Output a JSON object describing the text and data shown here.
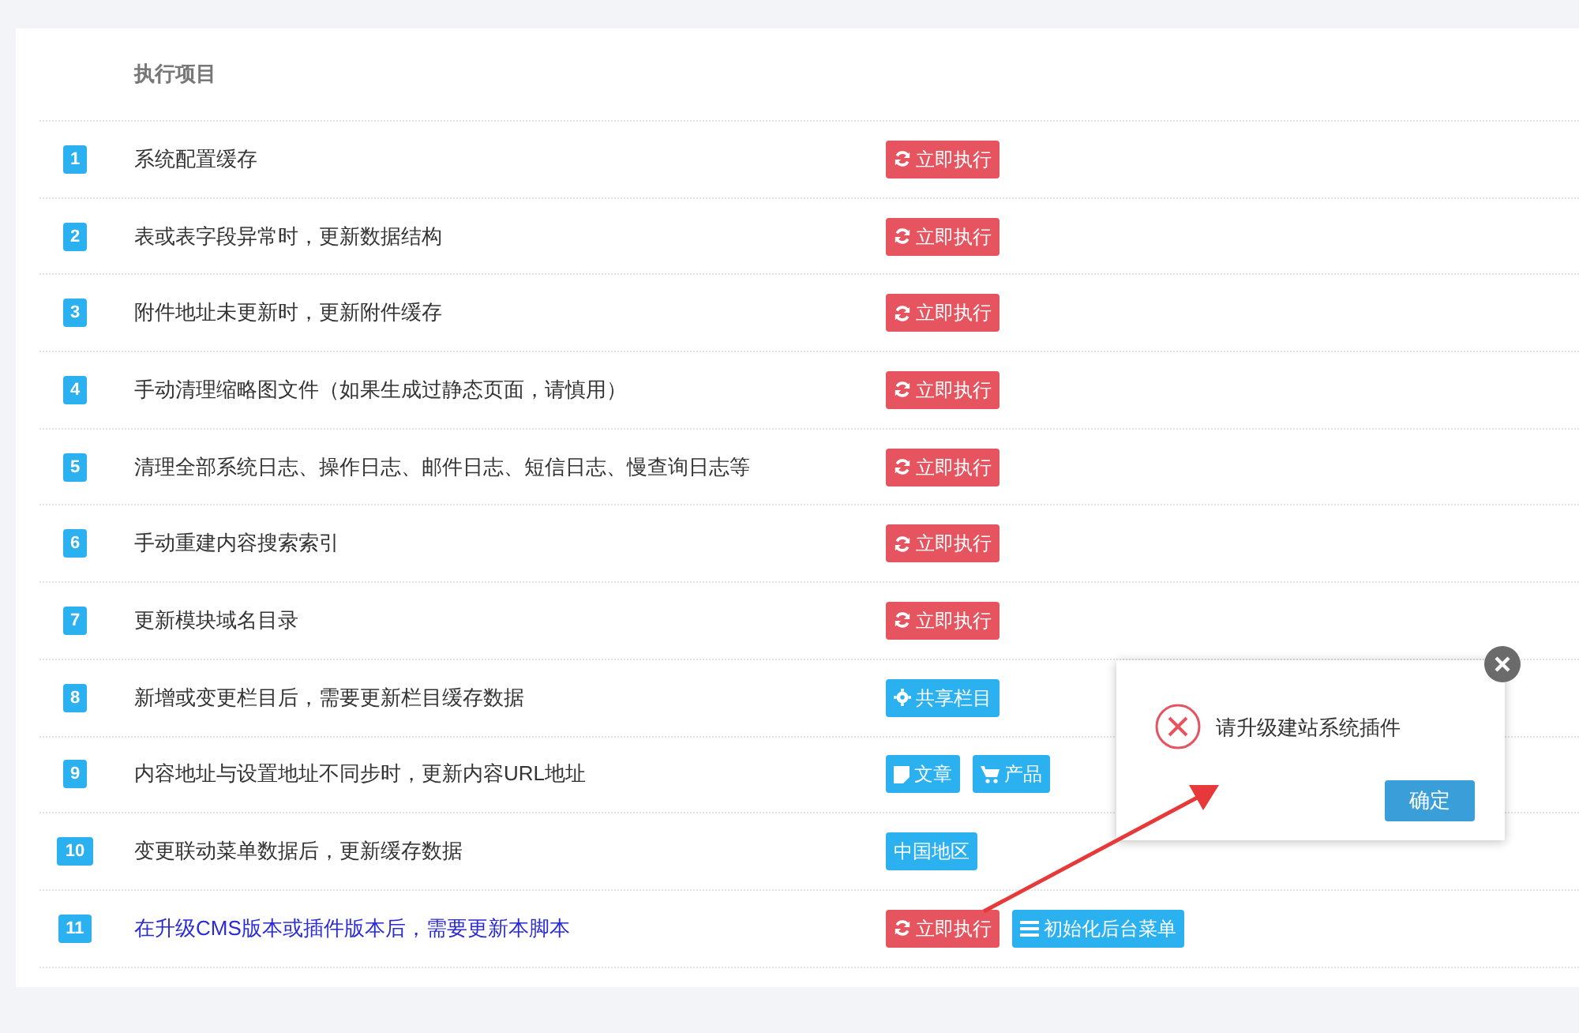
{
  "table": {
    "columns": [
      "执行项目"
    ],
    "rows": [
      {
        "index": "1",
        "label": "系统配置缓存",
        "highlight": false,
        "actions": [
          {
            "kind": "run",
            "label": "立即执行"
          }
        ]
      },
      {
        "index": "2",
        "label": "表或表字段异常时，更新数据结构",
        "highlight": false,
        "actions": [
          {
            "kind": "run",
            "label": "立即执行"
          }
        ]
      },
      {
        "index": "3",
        "label": "附件地址未更新时，更新附件缓存",
        "highlight": false,
        "actions": [
          {
            "kind": "run",
            "label": "立即执行"
          }
        ]
      },
      {
        "index": "4",
        "label": "手动清理缩略图文件（如果生成过静态页面，请慎用）",
        "highlight": false,
        "actions": [
          {
            "kind": "run",
            "label": "立即执行"
          }
        ]
      },
      {
        "index": "5",
        "label": "清理全部系统日志、操作日志、邮件日志、短信日志、慢查询日志等",
        "highlight": false,
        "actions": [
          {
            "kind": "run",
            "label": "立即执行"
          }
        ]
      },
      {
        "index": "6",
        "label": "手动重建内容搜索索引",
        "highlight": false,
        "actions": [
          {
            "kind": "run",
            "label": "立即执行"
          }
        ]
      },
      {
        "index": "7",
        "label": "更新模块域名目录",
        "highlight": false,
        "actions": [
          {
            "kind": "run",
            "label": "立即执行"
          }
        ]
      },
      {
        "index": "8",
        "label": "新增或变更栏目后，需要更新栏目缓存数据",
        "highlight": false,
        "actions": [
          {
            "kind": "gear",
            "label": "共享栏目"
          }
        ]
      },
      {
        "index": "9",
        "label": "内容地址与设置地址不同步时，更新内容URL地址",
        "highlight": false,
        "actions": [
          {
            "kind": "document",
            "label": "文章"
          },
          {
            "kind": "cart",
            "label": "产品"
          }
        ]
      },
      {
        "index": "10",
        "label": "变更联动菜单数据后，更新缓存数据",
        "highlight": false,
        "actions": [
          {
            "kind": "plain",
            "label": "中国地区"
          }
        ]
      },
      {
        "index": "11",
        "label": "在升级CMS版本或插件版本后，需要更新本脚本",
        "highlight": true,
        "actions": [
          {
            "kind": "run",
            "label": "立即执行"
          },
          {
            "kind": "list",
            "label": "初始化后台菜单"
          }
        ]
      }
    ]
  },
  "dialog": {
    "message": "请升级建站系统插件",
    "button": "确定"
  }
}
